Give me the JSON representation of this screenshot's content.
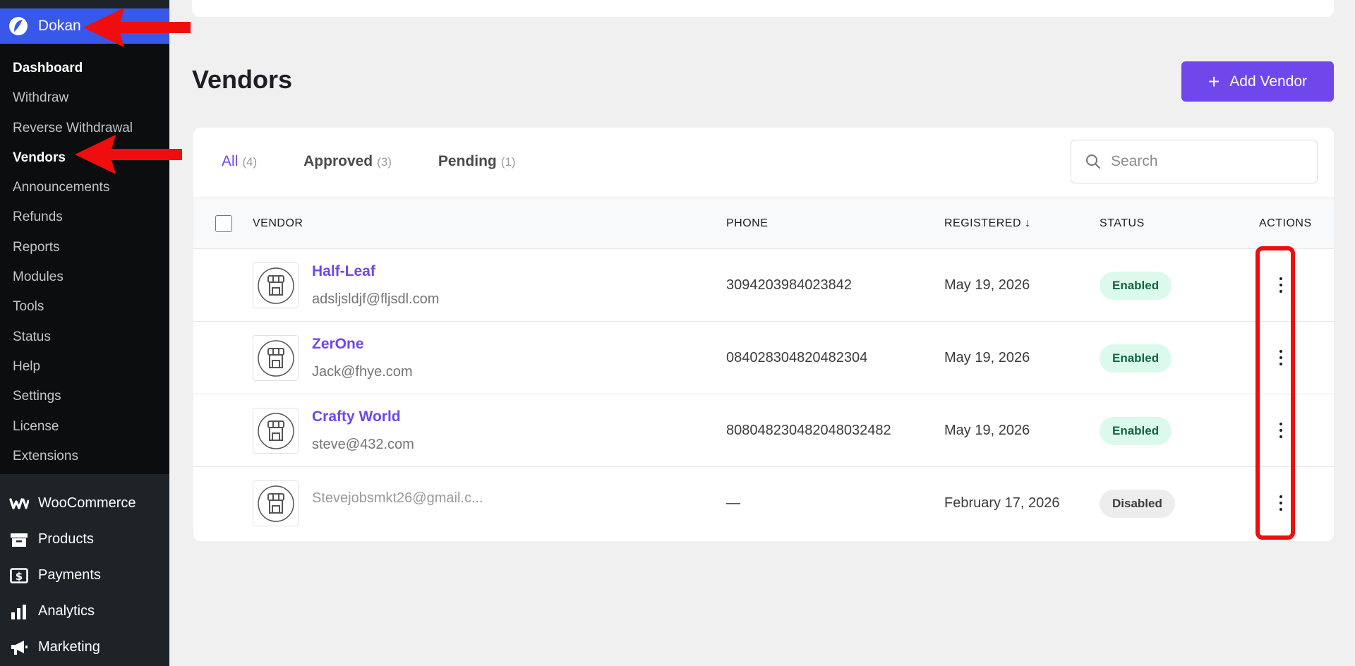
{
  "sidebar": {
    "brand": "Dokan",
    "submenu": [
      "Dashboard",
      "Withdraw",
      "Reverse Withdrawal",
      "Vendors",
      "Announcements",
      "Refunds",
      "Reports",
      "Modules",
      "Tools",
      "Status",
      "Help",
      "Settings",
      "License",
      "Extensions"
    ],
    "main": [
      {
        "label": "WooCommerce",
        "icon": "woocommerce-icon"
      },
      {
        "label": "Products",
        "icon": "archive-box-icon"
      },
      {
        "label": "Payments",
        "icon": "dollar-card-icon"
      },
      {
        "label": "Analytics",
        "icon": "bar-chart-icon"
      },
      {
        "label": "Marketing",
        "icon": "megaphone-icon"
      }
    ]
  },
  "header": {
    "title": "Vendors",
    "add_button": "Add Vendor"
  },
  "tabs": [
    {
      "label": "All",
      "count": "(4)"
    },
    {
      "label": "Approved",
      "count": "(3)"
    },
    {
      "label": "Pending",
      "count": "(1)"
    }
  ],
  "search": {
    "placeholder": "Search"
  },
  "table": {
    "columns": {
      "vendor": "VENDOR",
      "phone": "PHONE",
      "registered": "REGISTERED ↓",
      "status": "STATUS",
      "actions": "ACTIONS"
    },
    "rows": [
      {
        "name": "Half-Leaf",
        "email": "adsljsldjf@fljsdl.com",
        "phone": "3094203984023842",
        "registered": "May 19, 2026",
        "status": "Enabled"
      },
      {
        "name": "ZerOne",
        "email": "Jack@fhye.com",
        "phone": "084028304820482304",
        "registered": "May 19, 2026",
        "status": "Enabled"
      },
      {
        "name": "Crafty World",
        "email": "steve@432.com",
        "phone": "808048230482048032482",
        "registered": "May 19, 2026",
        "status": "Enabled"
      },
      {
        "name": "",
        "email": "Stevejobsmkt26@gmail.c...",
        "phone": "—",
        "registered": "February 17, 2026",
        "status": "Disabled"
      }
    ]
  },
  "colors": {
    "accent": "#7047eb",
    "sidebar": "#1d2327",
    "brand_bar": "#3858e9",
    "annotation": "#ef0d0d"
  }
}
